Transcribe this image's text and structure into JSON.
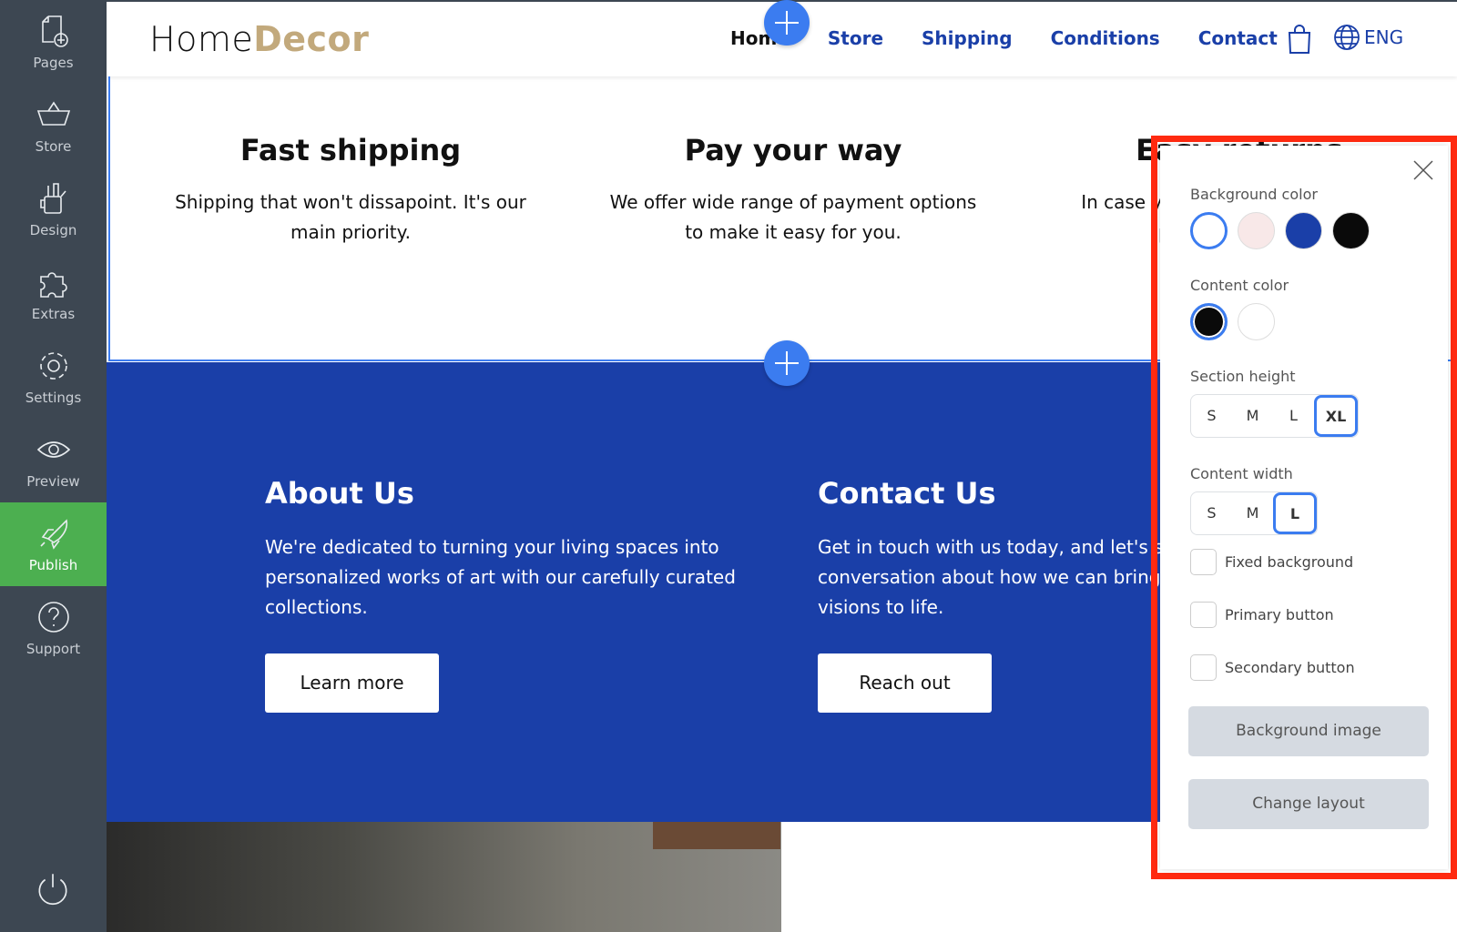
{
  "sidebar": {
    "items": [
      {
        "label": "Pages",
        "icon": "page-add-icon"
      },
      {
        "label": "Store",
        "icon": "basket-icon"
      },
      {
        "label": "Design",
        "icon": "design-tools-icon"
      },
      {
        "label": "Extras",
        "icon": "puzzle-icon"
      },
      {
        "label": "Settings",
        "icon": "gear-icon"
      },
      {
        "label": "Preview",
        "icon": "eye-icon"
      },
      {
        "label": "Publish",
        "icon": "rocket-icon",
        "active": true
      },
      {
        "label": "Support",
        "icon": "question-icon"
      }
    ],
    "power_icon": "power-icon"
  },
  "header": {
    "logo_light": "Home",
    "logo_bold": "Decor",
    "nav": [
      "Home",
      "Store",
      "Shipping",
      "Conditions",
      "Contact"
    ],
    "lang": "ENG"
  },
  "features": [
    {
      "title": "Fast shipping",
      "text": "Shipping that won't dissapoint. It's our main priority."
    },
    {
      "title": "Pay your way",
      "text": "We offer wide range of payment options to make it easy for you."
    },
    {
      "title": "Easy returns",
      "text": "In case you change your mind, the process is simple."
    }
  ],
  "blue": {
    "about": {
      "title": "About Us",
      "text": "We're dedicated to turning your living spaces into personalized works of art with our carefully curated collections.",
      "button": "Learn more"
    },
    "contact": {
      "title": "Contact Us",
      "text": "Get in touch with us today, and let's start a conversation about how we can bring your decor visions to life.",
      "button": "Reach out"
    }
  },
  "panel": {
    "bg_label": "Background color",
    "bg_colors": [
      "#ffffff",
      "#f8e8e8",
      "#1a3fa8",
      "#0a0a0a"
    ],
    "bg_selected": 0,
    "content_label": "Content color",
    "content_colors": [
      "#0a0a0a",
      "#ffffff"
    ],
    "content_selected": 0,
    "height_label": "Section height",
    "heights": [
      "S",
      "M",
      "L",
      "XL"
    ],
    "height_selected": "XL",
    "width_label": "Content width",
    "widths": [
      "S",
      "M",
      "L"
    ],
    "width_selected": "L",
    "checkboxes": [
      {
        "label": "Fixed background",
        "checked": false
      },
      {
        "label": "Primary button",
        "checked": false
      },
      {
        "label": "Secondary button",
        "checked": false
      }
    ],
    "bg_image_button": "Background image",
    "layout_button": "Change layout"
  },
  "colors": {
    "accent": "#3b7cf0",
    "brand_blue": "#1a3fa8",
    "logo_gold": "#c2a97c",
    "sidebar": "#3d4752",
    "publish": "#4caf50",
    "highlight": "#ff2a10"
  }
}
